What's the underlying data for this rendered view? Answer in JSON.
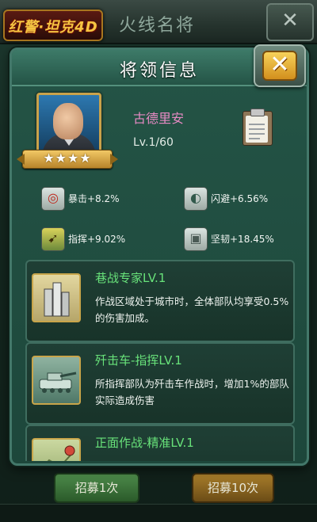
{
  "background": {
    "logo_text": "红警·坦克4D",
    "title": "火线名将",
    "close_glyph": "✕",
    "recruit_once": "招募1次",
    "recruit_ten": "招募10次"
  },
  "modal": {
    "title": "将领信息",
    "close_glyph": "✕",
    "general": {
      "name": "古德里安",
      "level": "Lv.1/60",
      "stars": "★★★★",
      "star_count": 4
    },
    "stats": [
      {
        "icon": "crit-target-icon",
        "glyph": "◎",
        "text": "暴击+8.2%"
      },
      {
        "icon": "dodge-icon",
        "glyph": "◐",
        "text": "闪避+6.56%"
      },
      {
        "icon": "command-icon",
        "glyph": "➹",
        "text": "指挥+9.02%"
      },
      {
        "icon": "armor-icon",
        "glyph": "▣",
        "text": "坚韧+18.45%"
      }
    ],
    "skills": [
      {
        "name": "巷战专家LV.1",
        "desc": "作战区域处于城市时，全体部队均享受0.5%的伤害加成。",
        "icon": "city-buildings-icon"
      },
      {
        "name": "歼击车-指挥LV.1",
        "desc": "所指挥部队为歼击车作战时，增加1%的部队实际造成伤害",
        "icon": "tank-destroyer-icon"
      },
      {
        "name": "正面作战-精准LV.1",
        "desc": "",
        "icon": "battle-map-icon"
      }
    ]
  },
  "colors": {
    "general_name": "#e78ac4",
    "skill_name": "#68e27a",
    "modal_bg": "#1d473b"
  }
}
